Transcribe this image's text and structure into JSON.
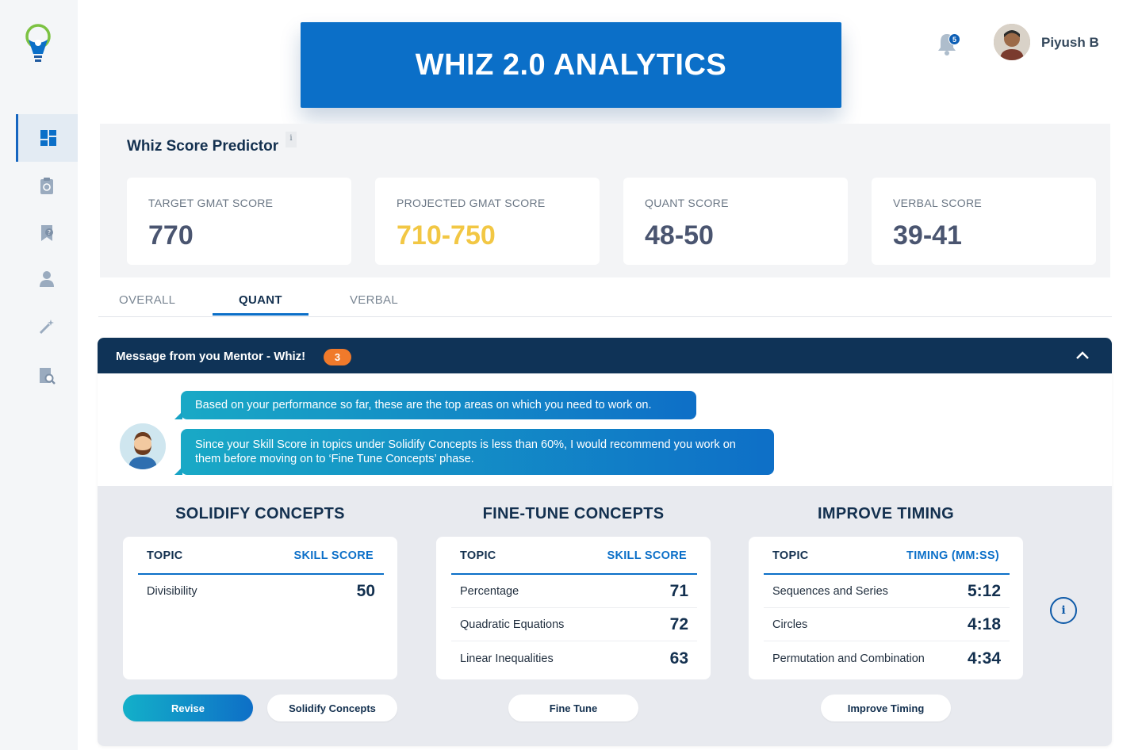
{
  "app": {
    "banner_title": "WHIZ 2.0 ANALYTICS"
  },
  "header": {
    "notifications_count": "5",
    "user_name": "Piyush B"
  },
  "predictor": {
    "title": "Whiz Score Predictor",
    "info_glyph": "i",
    "cards": [
      {
        "label": "TARGET GMAT SCORE",
        "value": "770"
      },
      {
        "label": "PROJECTED GMAT SCORE",
        "value": "710-750"
      },
      {
        "label": "QUANT SCORE",
        "value": "48-50"
      },
      {
        "label": "VERBAL SCORE",
        "value": "39-41"
      }
    ]
  },
  "tabs": [
    {
      "label": "OVERALL"
    },
    {
      "label": "QUANT"
    },
    {
      "label": "VERBAL"
    }
  ],
  "mentor": {
    "title": "Message from you Mentor - Whiz!",
    "badge": "3",
    "messages": [
      "Based on your performance so far, these are the top areas on which you need to work on.",
      "Since your Skill Score in topics under Solidify Concepts is less than 60%, I would recommend you work on them before moving on to ‘Fine Tune Concepts’ phase."
    ]
  },
  "sections": [
    {
      "title": "SOLIDIFY CONCEPTS",
      "col_topic": "TOPIC",
      "col_value": "SKILL SCORE",
      "rows": [
        {
          "topic": "Divisibility",
          "value": "50"
        }
      ]
    },
    {
      "title": "FINE-TUNE CONCEPTS",
      "col_topic": "TOPIC",
      "col_value": "SKILL SCORE",
      "rows": [
        {
          "topic": "Percentage",
          "value": "71"
        },
        {
          "topic": "Quadratic Equations",
          "value": "72"
        },
        {
          "topic": "Linear Inequalities",
          "value": "63"
        }
      ]
    },
    {
      "title": "IMPROVE TIMING",
      "col_topic": "TOPIC",
      "col_value": "TIMING (MM:SS)",
      "rows": [
        {
          "topic": "Sequences and Series",
          "value": "5:12"
        },
        {
          "topic": "Circles",
          "value": "4:18"
        },
        {
          "topic": "Permutation and Combination",
          "value": "4:34"
        }
      ]
    }
  ],
  "buttons": {
    "revise": "Revise",
    "solidify": "Solidify Concepts",
    "fine_tune": "Fine Tune",
    "improve_timing": "Improve Timing",
    "info_glyph": "i"
  },
  "colors": {
    "accent": "#0b6fc8",
    "header_dark": "#0f3357",
    "projected": "#f2c744",
    "badge": "#f07a2b"
  },
  "icons": [
    "lightbulb-logo",
    "dashboard-icon",
    "clipboard-icon",
    "bookmark-question-icon",
    "user-icon",
    "magic-wand-icon",
    "document-search-icon",
    "bell-icon",
    "chevron-up-icon",
    "info-icon"
  ]
}
